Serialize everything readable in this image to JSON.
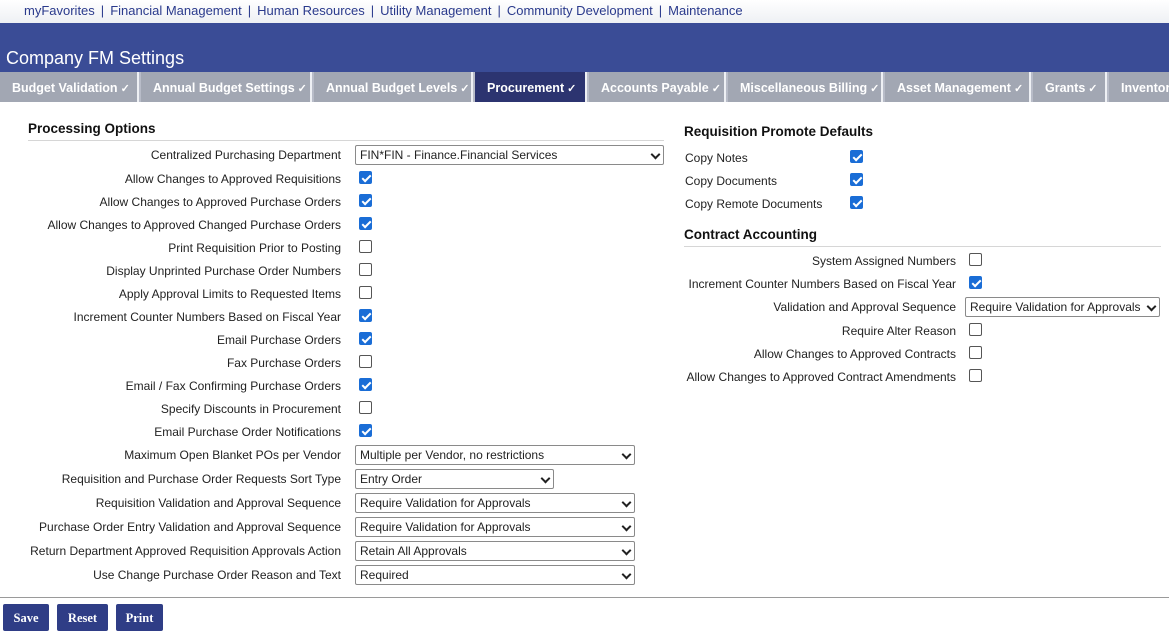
{
  "topnav": {
    "links": [
      "myFavorites",
      "Financial Management",
      "Human Resources",
      "Utility Management",
      "Community Development",
      "Maintenance"
    ],
    "separator": "|"
  },
  "header": {
    "title": "Company FM Settings"
  },
  "tabs": [
    {
      "label": "Budget Validation",
      "check": "✓",
      "active": false
    },
    {
      "label": "Annual Budget Settings",
      "check": "✓",
      "active": false
    },
    {
      "label": "Annual Budget Levels",
      "check": "✓",
      "active": false
    },
    {
      "label": "Procurement",
      "check": "✓",
      "active": true
    },
    {
      "label": "Accounts Payable",
      "check": "✓",
      "active": false
    },
    {
      "label": "Miscellaneous Billing",
      "check": "✓",
      "active": false
    },
    {
      "label": "Asset Management",
      "check": "✓",
      "active": false
    },
    {
      "label": "Grants",
      "check": "✓",
      "active": false
    },
    {
      "label": "Inventory",
      "check": "",
      "active": false
    }
  ],
  "processing": {
    "title": "Processing Options",
    "centralized_label": "Centralized Purchasing Department",
    "centralized_value": "FIN*FIN - Finance.Financial Services",
    "checks": [
      {
        "label": "Allow Changes to Approved Requisitions",
        "checked": true
      },
      {
        "label": "Allow Changes to Approved Purchase Orders",
        "checked": true
      },
      {
        "label": "Allow Changes to Approved Changed Purchase Orders",
        "checked": true
      },
      {
        "label": "Print Requisition Prior to Posting",
        "checked": false
      },
      {
        "label": "Display Unprinted Purchase Order Numbers",
        "checked": false
      },
      {
        "label": "Apply Approval Limits to Requested Items",
        "checked": false
      },
      {
        "label": "Increment Counter Numbers Based on Fiscal Year",
        "checked": true
      },
      {
        "label": "Email Purchase Orders",
        "checked": true
      },
      {
        "label": "Fax Purchase Orders",
        "checked": false
      },
      {
        "label": "Email / Fax Confirming Purchase Orders",
        "checked": true
      },
      {
        "label": "Specify Discounts in Procurement",
        "checked": false
      },
      {
        "label": "Email Purchase Order Notifications",
        "checked": true
      }
    ],
    "selects": [
      {
        "label": "Maximum Open Blanket POs per Vendor",
        "value": "Multiple per Vendor, no restrictions"
      },
      {
        "label": "Requisition and Purchase Order Requests Sort Type",
        "value": "Entry Order"
      },
      {
        "label": "Requisition Validation and Approval Sequence",
        "value": "Require Validation for Approvals"
      },
      {
        "label": "Purchase Order Entry Validation and Approval Sequence",
        "value": "Require Validation for Approvals"
      },
      {
        "label": "Return Department Approved Requisition Approvals Action",
        "value": "Retain All Approvals"
      },
      {
        "label": "Use Change Purchase Order Reason and Text",
        "value": "Required"
      }
    ]
  },
  "requisition_promote": {
    "title": "Requisition Promote Defaults",
    "checks": [
      {
        "label": "Copy Notes",
        "checked": true
      },
      {
        "label": "Copy Documents",
        "checked": true
      },
      {
        "label": "Copy Remote Documents",
        "checked": true
      }
    ]
  },
  "contract": {
    "title": "Contract Accounting",
    "rows": [
      {
        "label": "System Assigned Numbers",
        "checked": false
      },
      {
        "label": "Increment Counter Numbers Based on Fiscal Year",
        "checked": true
      },
      {
        "label": "Validation and Approval Sequence",
        "value": "Require Validation for Approvals"
      },
      {
        "label": "Require Alter Reason",
        "checked": false
      },
      {
        "label": "Allow Changes to Approved Contracts",
        "checked": false
      },
      {
        "label": "Allow Changes to Approved Contract Amendments",
        "checked": false
      }
    ]
  },
  "buttons": {
    "save": "Save",
    "reset": "Reset",
    "print": "Print"
  },
  "colors": {
    "header": "#3a4c96",
    "active_tab": "#2c3470",
    "checkbox": "#1a6dd6",
    "button": "#2f3d86"
  }
}
